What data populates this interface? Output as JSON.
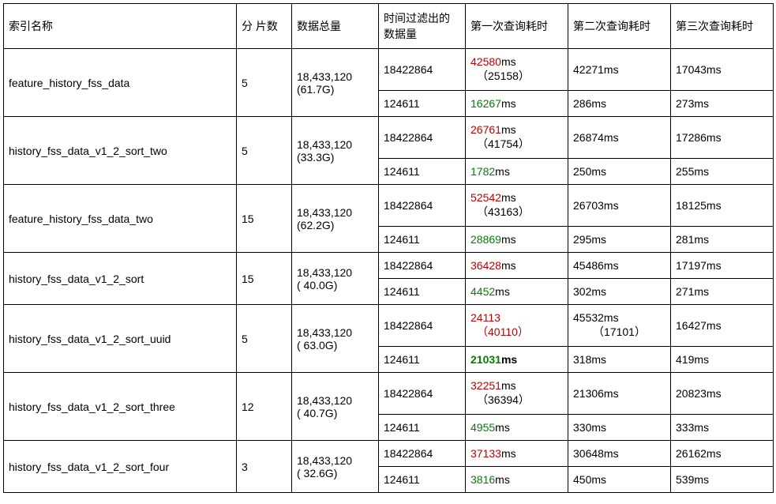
{
  "headers": {
    "index_name": "索引名称",
    "shards": "分 片数",
    "total": "数据总量",
    "filtered": "时间过滤出的数据量",
    "q1": "第一次查询耗时",
    "q2": "第二次查询耗时",
    "q3": "第三次查询耗时"
  },
  "rows": [
    {
      "index": "feature_history_fss_data",
      "shards": "5",
      "total_num": "18,433,120",
      "total_size": "(61.7G)",
      "sub": [
        {
          "filtered": "18422864",
          "q1_main": "42580ms",
          "q1_color": "red",
          "q1_paren": "（25158）",
          "q2": "42271ms",
          "q2_paren": "",
          "q3": "17043ms"
        },
        {
          "filtered": "124611",
          "q1_main": "16267ms",
          "q1_color": "green",
          "q1_paren": "",
          "q2": "286ms",
          "q2_paren": "",
          "q3": "273ms"
        }
      ]
    },
    {
      "index": "history_fss_data_v1_2_sort_two",
      "shards": "5",
      "total_num": "18,433,120",
      "total_size": "(33.3G)",
      "sub": [
        {
          "filtered": "18422864",
          "q1_main": "26761ms",
          "q1_color": "red",
          "q1_paren": "（41754）",
          "q2": "26874ms",
          "q2_paren": "",
          "q3": "17286ms"
        },
        {
          "filtered": "124611",
          "q1_main": "1782ms",
          "q1_color": "green",
          "q1_paren": "",
          "q2": "250ms",
          "q2_paren": "",
          "q3": "255ms"
        }
      ]
    },
    {
      "index": "feature_history_fss_data_two",
      "shards": "15",
      "total_num": "18,433,120",
      "total_size": "(62.2G)",
      "sub": [
        {
          "filtered": "18422864",
          "q1_main": "52542ms",
          "q1_color": "red",
          "q1_paren": "（43163）",
          "q2": "26703ms",
          "q2_paren": "",
          "q3": "18125ms"
        },
        {
          "filtered": "124611",
          "q1_main": "28869ms",
          "q1_color": "green",
          "q1_paren": "",
          "q2": "295ms",
          "q2_paren": "",
          "q3": "281ms"
        }
      ]
    },
    {
      "index": "history_fss_data_v1_2_sort",
      "shards": "15",
      "total_num": "18,433,120",
      "total_size": "( 40.0G)",
      "sub": [
        {
          "filtered": "18422864",
          "q1_main": "36428ms",
          "q1_color": "red",
          "q1_paren": "",
          "q2": "45486ms",
          "q2_paren": "",
          "q3": "17197ms"
        },
        {
          "filtered": "124611",
          "q1_main": "4452ms",
          "q1_color": "green",
          "q1_paren": "",
          "q2": "302ms",
          "q2_paren": "",
          "q3": "271ms"
        }
      ]
    },
    {
      "index": "history_fss_data_v1_2_sort_uuid",
      "shards": "5",
      "total_num": "18,433,120",
      "total_size": "( 63.0G)",
      "sub": [
        {
          "filtered": "18422864",
          "q1_main": "24113",
          "q1_color": "red",
          "q1_paren": "（40110）",
          "q1_paren_red": true,
          "q2": "45532ms",
          "q2_paren": "（17101）",
          "q3": "16427ms"
        },
        {
          "filtered": "124611",
          "q1_main": "21031ms",
          "q1_color": "green",
          "q1_bold": true,
          "q1_paren": "",
          "q2": "318ms",
          "q2_paren": "",
          "q3": "419ms"
        }
      ]
    },
    {
      "index": "history_fss_data_v1_2_sort_three",
      "shards": "12",
      "total_num": "18,433,120",
      "total_size": "( 40.7G)",
      "sub": [
        {
          "filtered": "18422864",
          "q1_main": "32251ms",
          "q1_color": "red",
          "q1_paren": "（36394）",
          "q2": "21306ms",
          "q2_paren": "",
          "q3": "20823ms"
        },
        {
          "filtered": "124611",
          "q1_main": "4955ms",
          "q1_color": "green",
          "q1_paren": "",
          "q2": "330ms",
          "q2_paren": "",
          "q3": "333ms"
        }
      ]
    },
    {
      "index": "history_fss_data_v1_2_sort_four",
      "shards": "3",
      "total_num": "18,433,120",
      "total_size": "( 32.6G)",
      "sub": [
        {
          "filtered": "18422864",
          "q1_main": "37133ms",
          "q1_color": "red",
          "q1_paren": "",
          "q2": "30648ms",
          "q2_paren": "",
          "q3": "26162ms"
        },
        {
          "filtered": "124611",
          "q1_main": "3816ms",
          "q1_color": "green",
          "q1_paren": "",
          "q2": "450ms",
          "q2_paren": "",
          "q3": "539ms"
        }
      ]
    }
  ]
}
